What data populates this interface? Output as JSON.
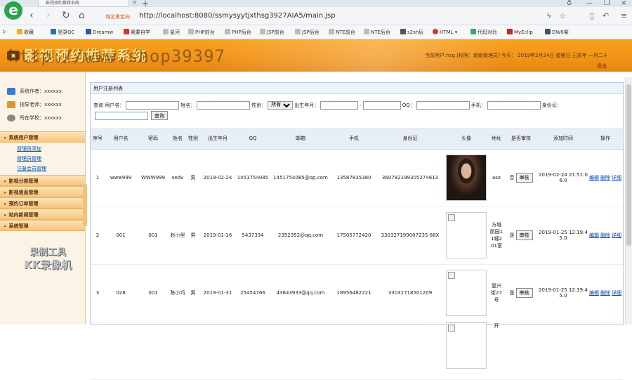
{
  "browser": {
    "tab_title": "影视预约推荐系统",
    "url_tag": "域名重定向",
    "url": "http://localhost:8080/ssmysyytjxthsg3927AIA5/main.jsp",
    "bookmarks": [
      "收藏",
      "登录QC",
      "Dreamw",
      "我要自学",
      "星河",
      "PHP前台",
      "PHP后台",
      "JSP前台",
      "JSP后台",
      "NTE前台",
      "NTE后台",
      "s2sh后",
      "HTML",
      "代码对比",
      "MyEclip",
      "DW8架"
    ]
  },
  "header": {
    "title": "影视预约推荐系统",
    "watermark": "http://www.shop39397",
    "user_info": "当前用户:hsg [权限：超级管理员] 今天： 2019年2月24日 星期日 己亥年 一月二十",
    "logout": "退出"
  },
  "sidebar": {
    "info": [
      {
        "label": "系统作者：xxxxxx",
        "color": "#3a7bd5"
      },
      {
        "label": "指导老师：xxxxxx",
        "color": "#d59a2a"
      },
      {
        "label": "所在学校：xxxxxx",
        "color": "#888888"
      }
    ],
    "menu": [
      {
        "title": "系统用户管理",
        "items": [
          "管理员添加",
          "管理员管理",
          "注册会员管理"
        ]
      },
      {
        "title": "影视分类管理",
        "items": []
      },
      {
        "title": "影视信息管理",
        "items": []
      },
      {
        "title": "预约订单管理",
        "items": []
      },
      {
        "title": "站内新闻管理",
        "items": []
      },
      {
        "title": "系统管理",
        "items": []
      }
    ],
    "badge": {
      "line1": "录制工具",
      "line2": "KK录像机"
    }
  },
  "main": {
    "panel_title": "用户注册列表",
    "search": {
      "label": "查询",
      "username": "用户名：",
      "name": "姓名：",
      "gender": "性别：",
      "gender_option": "所有",
      "birth": "出生年月：",
      "qq": "QQ：",
      "phone": "手机：",
      "idcard": "身份证：",
      "submit": "查询"
    },
    "columns": [
      "序号",
      "用户名",
      "密码",
      "姓名",
      "性别",
      "出生年月",
      "QQ",
      "邮箱",
      "手机",
      "身份证",
      "头像",
      "地址",
      "是否审核",
      "添加时间",
      "操作"
    ],
    "rows": [
      {
        "no": "1",
        "user": "www999",
        "pwd": "WWW999",
        "name": "sedv",
        "gender": "男",
        "birth": "2019-02-24",
        "qq": "1451754085",
        "email": "1451754085@qq.com",
        "phone": "13587835380",
        "idcard": "360782199305274613",
        "photo": "real",
        "addr": "asx",
        "audit": "否",
        "audit_btn": "审核",
        "time": "2019-02-24 21:51:06.0"
      },
      {
        "no": "2",
        "user": "001",
        "pwd": "001",
        "name": "赵小型",
        "gender": "男",
        "birth": "2019-01-16",
        "qq": "5437334",
        "email": "2352352@qq.com",
        "phone": "17505772420",
        "idcard": "330327199007235 68X",
        "photo": "broken",
        "addr": "方城丽园11幢201室",
        "audit": "是",
        "audit_btn": "审核",
        "time": "2019-01-25 12:19:45.0"
      },
      {
        "no": "3",
        "user": "028",
        "pwd": "001",
        "name": "陈小巧",
        "gender": "男",
        "birth": "2019-01-31",
        "qq": "25454766",
        "email": "43643933@qq.com",
        "phone": "18956482221",
        "idcard": "33032718501209",
        "photo": "broken",
        "addr": "复兴街27号",
        "audit": "是",
        "audit_btn": "审核",
        "time": "2019-01-25 12:19:45.0"
      },
      {
        "no": "",
        "user": "",
        "pwd": "",
        "name": "",
        "gender": "",
        "birth": "",
        "qq": "",
        "email": "",
        "phone": "",
        "idcard": "",
        "photo": "broken",
        "addr": "开",
        "audit": "",
        "audit_btn": "",
        "time": ""
      }
    ],
    "ops": [
      "编辑",
      "删除",
      "详细"
    ]
  }
}
